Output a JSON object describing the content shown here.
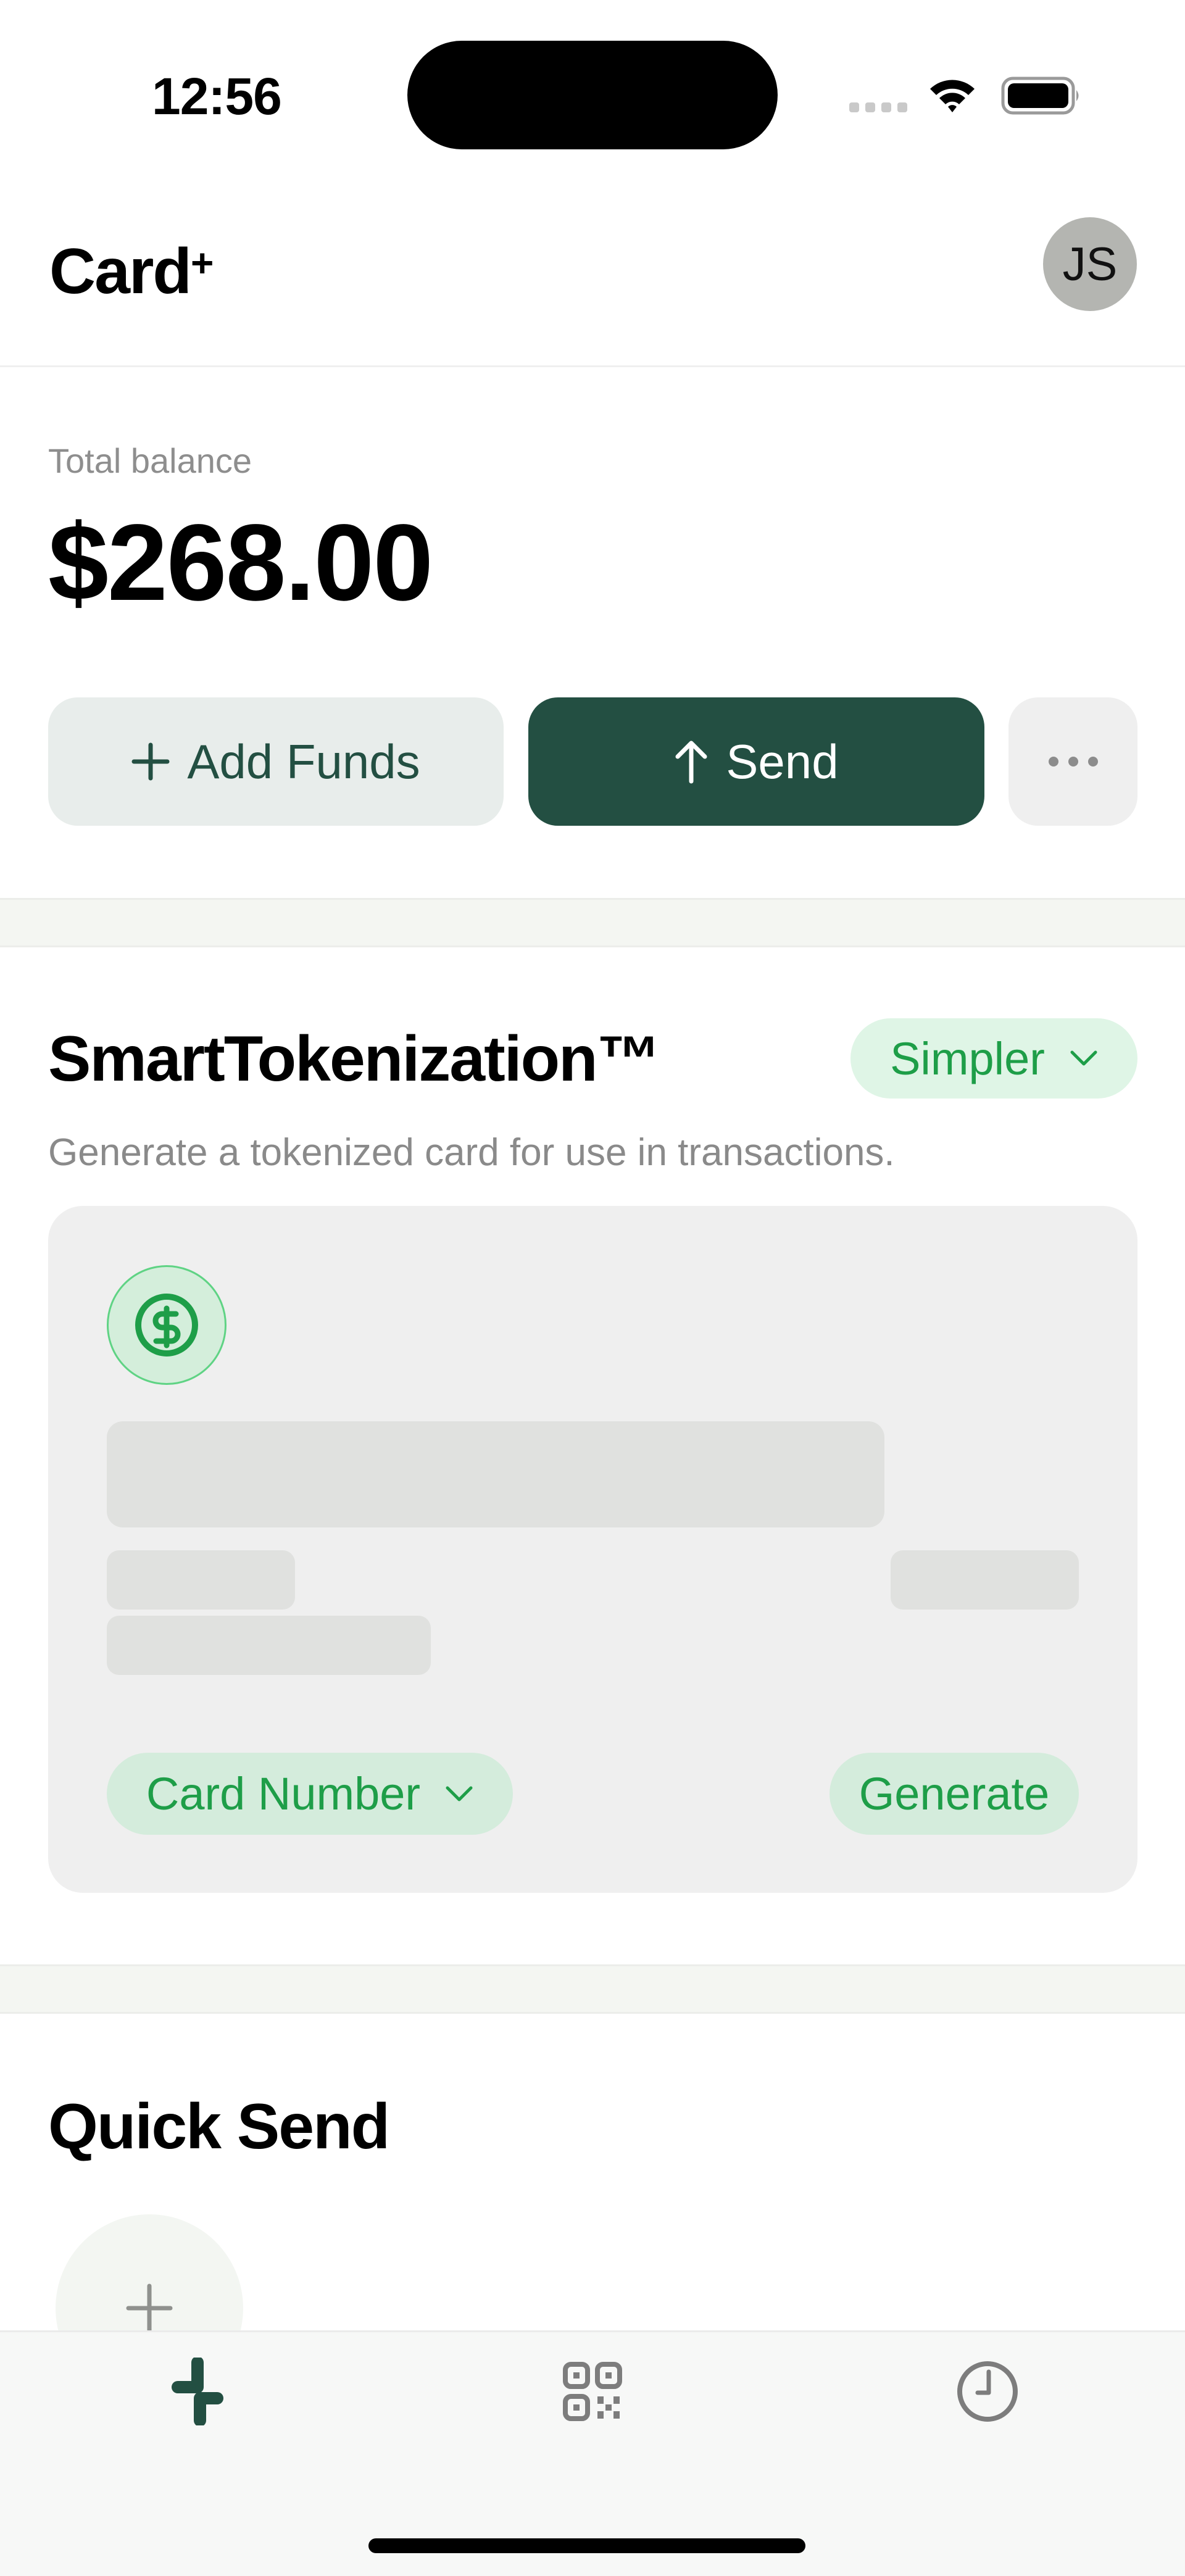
{
  "status_bar": {
    "time": "12:56",
    "icons": [
      "cellular-signal-icon",
      "wifi-icon",
      "battery-icon"
    ]
  },
  "header": {
    "app_name": "Card",
    "app_name_suffix": "+",
    "avatar_initials": "JS"
  },
  "balance": {
    "label": "Total balance",
    "amount": "$268.00"
  },
  "actions": {
    "add_funds_label": "Add Funds",
    "add_funds_icon": "plus-icon",
    "send_label": "Send",
    "send_icon": "arrow-up-icon",
    "more_icon": "ellipsis-icon"
  },
  "smart_tokenization": {
    "title": "SmartTokenization™",
    "mode_selector": {
      "selected": "Simpler",
      "icon": "chevron-down-icon"
    },
    "description": "Generate a tokenized card for use in transactions.",
    "card": {
      "icon": "dollar-circle-icon",
      "type_selector": {
        "selected": "Card Number",
        "icon": "chevron-down-icon"
      },
      "generate_label": "Generate"
    }
  },
  "quick_send": {
    "title": "Quick Send",
    "add_icon": "plus-icon"
  },
  "tab_bar": {
    "tabs": [
      {
        "name": "home",
        "icon": "card-plus-logo-icon",
        "active": true
      },
      {
        "name": "scan",
        "icon": "qr-code-icon",
        "active": false
      },
      {
        "name": "history",
        "icon": "clock-icon",
        "active": false
      }
    ]
  },
  "colors": {
    "brand_dark_green": "#234f42",
    "accent_green": "#1e9e48",
    "accent_green_bg": "#dff5e6",
    "muted_text": "#8a8a8a"
  }
}
